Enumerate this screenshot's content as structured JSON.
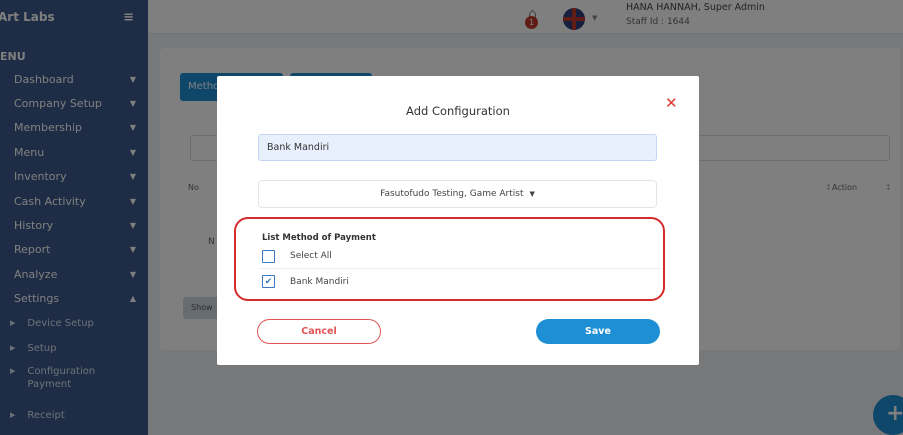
{
  "sidebar": {
    "brand": "Art Labs",
    "menu_title": "ENU",
    "items": [
      {
        "label": "Dashboard"
      },
      {
        "label": "Company Setup"
      },
      {
        "label": "Membership"
      },
      {
        "label": "Menu"
      },
      {
        "label": "Inventory"
      },
      {
        "label": "Cash Activity"
      },
      {
        "label": "History"
      },
      {
        "label": "Report"
      },
      {
        "label": "Analyze"
      },
      {
        "label": "Settings"
      }
    ],
    "sub_items": [
      {
        "label": "Device Setup"
      },
      {
        "label": "Setup"
      },
      {
        "label": "Configuration Payment"
      },
      {
        "label": "Receipt"
      }
    ]
  },
  "topbar": {
    "notification_count": "1",
    "user_name": "HANA HANNAH, Super Admin",
    "staff_id": "Staff Id : 1644"
  },
  "background": {
    "tab_label": "Metho",
    "col_no": "No",
    "col_action": "Action",
    "row_marker": "N",
    "show_label": "Show"
  },
  "modal": {
    "title": "Add Configuration",
    "name_value": "Bank Mandiri",
    "select_value": "Fasutofudo Testing, Game Artist",
    "payment_section_title": "List Method of Payment",
    "payment_options": [
      {
        "label": "Select All",
        "checked": false
      },
      {
        "label": "Bank Mandiri",
        "checked": true
      }
    ],
    "cancel_label": "Cancel",
    "save_label": "Save"
  },
  "colors": {
    "primary": "#1e8fd5",
    "sidebar": "#3c5a8a",
    "danger": "#e53935"
  }
}
